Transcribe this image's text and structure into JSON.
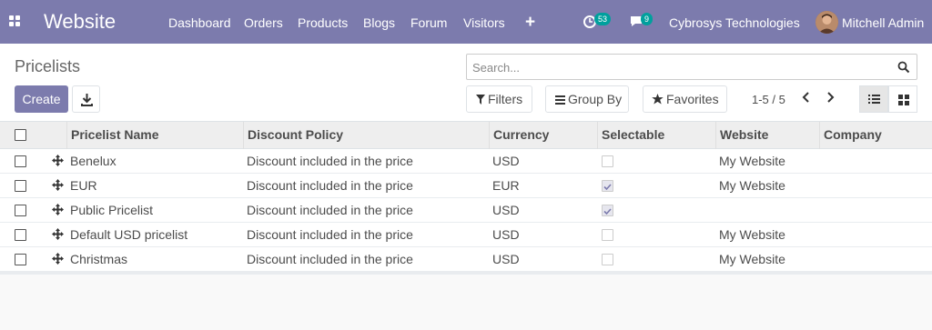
{
  "navbar": {
    "brand": "Website",
    "menu": [
      "Dashboard",
      "Orders",
      "Products",
      "Blogs",
      "Forum",
      "Visitors"
    ],
    "activity_count": "53",
    "messages_count": "9",
    "company": "Cybrosys Technologies",
    "user": "Mitchell Admin"
  },
  "control_panel": {
    "title": "Pricelists",
    "create_label": "Create",
    "search_placeholder": "Search...",
    "filters_label": "Filters",
    "groupby_label": "Group By",
    "favorites_label": "Favorites",
    "pager": "1-5 / 5"
  },
  "table": {
    "columns": [
      "Pricelist Name",
      "Discount Policy",
      "Currency",
      "Selectable",
      "Website",
      "Company"
    ],
    "rows": [
      {
        "name": "Benelux",
        "policy": "Discount included in the price",
        "currency": "USD",
        "selectable": false,
        "website": "My Website",
        "company": ""
      },
      {
        "name": "EUR",
        "policy": "Discount included in the price",
        "currency": "EUR",
        "selectable": true,
        "website": "My Website",
        "company": ""
      },
      {
        "name": "Public Pricelist",
        "policy": "Discount included in the price",
        "currency": "USD",
        "selectable": true,
        "website": "",
        "company": ""
      },
      {
        "name": "Default USD pricelist",
        "policy": "Discount included in the price",
        "currency": "USD",
        "selectable": false,
        "website": "My Website",
        "company": ""
      },
      {
        "name": "Christmas",
        "policy": "Discount included in the price",
        "currency": "USD",
        "selectable": false,
        "website": "My Website",
        "company": ""
      }
    ]
  },
  "colors": {
    "navbar": "#7c7bad",
    "primary": "#7c7bad",
    "badge": "#00a09d"
  }
}
